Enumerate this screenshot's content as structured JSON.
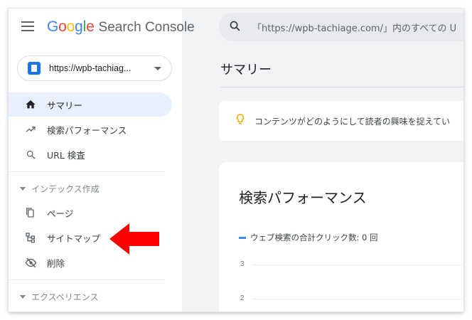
{
  "header": {
    "logo_google": [
      "G",
      "o",
      "o",
      "g",
      "l",
      "e"
    ],
    "logo_product": "Search Console"
  },
  "property": {
    "label": "https://wpb-tachiag..."
  },
  "nav": {
    "summary": "サマリー",
    "performance": "検索パフォーマンス",
    "url_inspection": "URL 検査",
    "section_index": "インデックス作成",
    "pages": "ページ",
    "sitemaps": "サイトマップ",
    "removals": "削除",
    "section_experience": "エクスペリエンス"
  },
  "search": {
    "placeholder": "「https://wpb-tachiage.com/」内のすべての U"
  },
  "main": {
    "page_title": "サマリー",
    "tip_text": "コンテンツがどのようにして読者の興味を捉えてい",
    "card_title": "検索パフォーマンス",
    "legend_label": "ウェブ検索の合計クリック数: 0 回"
  },
  "colors": {
    "accent": "#1a73e8",
    "active_bg": "#e8f0fe",
    "arrow": "#ff0000",
    "tip_bulb": "#f9ab00"
  },
  "chart_data": {
    "type": "line",
    "y_ticks": [
      "3",
      "2"
    ],
    "series": [
      {
        "name": "ウェブ検索の合計クリック数: 0 回",
        "values": []
      }
    ]
  }
}
